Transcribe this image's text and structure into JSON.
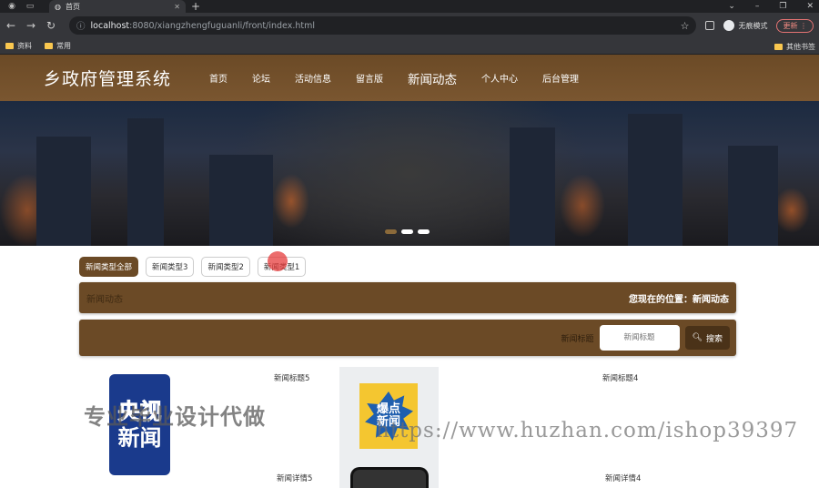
{
  "browser": {
    "tab_title": "首页",
    "url_host": "localhost",
    "url_path": ":8080/xiangzhengfuguanli/front/index.html",
    "profile_label": "无痕模式",
    "update_label": "更新",
    "bookmarks": [
      "资料",
      "常用"
    ],
    "bookmarks_right": "其他书签"
  },
  "site": {
    "title": "乡政府管理系统",
    "nav": [
      "首页",
      "论坛",
      "活动信息",
      "留言版",
      "新闻动态",
      "个人中心",
      "后台管理"
    ],
    "active_nav": "新闻动态"
  },
  "filters": [
    "新闻类型全部",
    "新闻类型3",
    "新闻类型2",
    "新闻类型1"
  ],
  "breadcrumb": {
    "section": "新闻动态",
    "location": "您现在的位置：新闻动态"
  },
  "search": {
    "label": "新闻标题",
    "placeholder": "新闻标题",
    "button": "搜索"
  },
  "news": [
    {
      "title": "新闻标题5",
      "detail": "新闻详情5",
      "thumb": {
        "line1": "央视",
        "line2": "新闻"
      }
    },
    {
      "title": "新闻标题4",
      "detail": "新闻详情4",
      "thumb": {
        "line1": "爆点",
        "line2": "新闻"
      }
    }
  ],
  "watermarks": {
    "left": "专业毕业设计代做",
    "right": "https://www.huzhan.com/ishop39397"
  },
  "colors": {
    "brand": "#6b4a26",
    "brand_dark": "#4a3218"
  }
}
